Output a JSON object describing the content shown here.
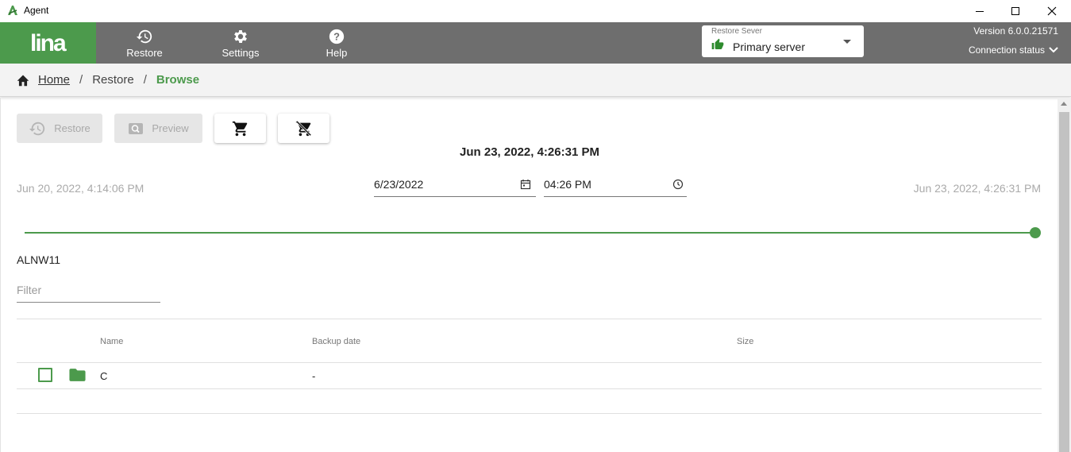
{
  "window": {
    "title": "Agent"
  },
  "nav": {
    "logo_text": "lina",
    "items": [
      {
        "label": "Restore",
        "icon": "history-icon"
      },
      {
        "label": "Settings",
        "icon": "gear-icon"
      },
      {
        "label": "Help",
        "icon": "help-icon"
      }
    ],
    "restore_server": {
      "label": "Restore Sever",
      "value": "Primary server"
    },
    "version": "Version 6.0.0.21571",
    "connection_status": "Connection status"
  },
  "breadcrumb": {
    "home": "Home",
    "restore": "Restore",
    "current": "Browse"
  },
  "toolbar": {
    "restore_label": "Restore",
    "preview_label": "Preview"
  },
  "timeline": {
    "selected": "Jun 23, 2022, 4:26:31 PM",
    "start": "Jun 20, 2022, 4:14:06 PM",
    "end": "Jun 23, 2022, 4:26:31 PM",
    "date_value": "6/23/2022",
    "time_value": "04:26  PM",
    "slider_position": 1.0
  },
  "browser": {
    "host": "ALNW11",
    "filter_placeholder": "Filter",
    "columns": {
      "name": "Name",
      "backup_date": "Backup date",
      "size": "Size"
    },
    "rows": [
      {
        "name": "C",
        "backup_date": "-",
        "size": ""
      }
    ]
  },
  "colors": {
    "accent": "#4c9a4c",
    "nav_bg": "#6e6e6e"
  }
}
